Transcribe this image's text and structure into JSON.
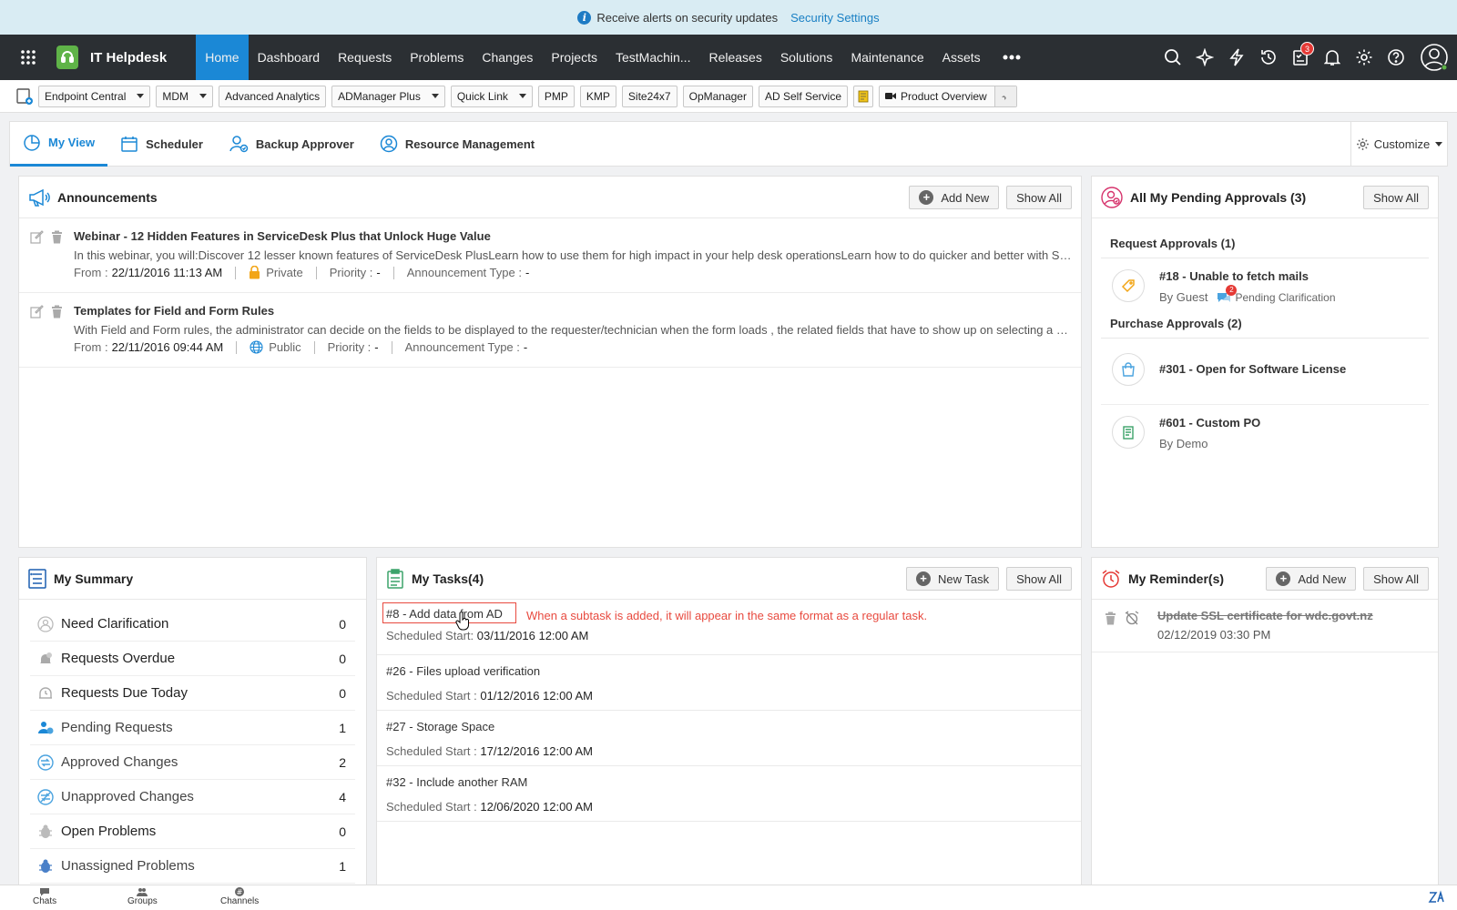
{
  "alert": {
    "text": "Receive alerts on security updates",
    "link": "Security Settings"
  },
  "nav": {
    "brand": "IT Helpdesk",
    "tabs": [
      "Home",
      "Dashboard",
      "Requests",
      "Problems",
      "Changes",
      "Projects",
      "TestMachin...",
      "Releases",
      "Solutions",
      "Maintenance",
      "Assets"
    ],
    "active_tab": "Home",
    "tasks_badge": "3"
  },
  "toolbar": {
    "buttons": [
      "Endpoint Central",
      "MDM",
      "Advanced Analytics",
      "ADManager Plus",
      "Quick Link",
      "PMP",
      "KMP",
      "Site24x7",
      "OpManager",
      "AD Self Service",
      "Product Overview"
    ]
  },
  "subtabs": {
    "tabs": [
      "My View",
      "Scheduler",
      "Backup Approver",
      "Resource Management"
    ],
    "customize": "Customize"
  },
  "announcements": {
    "title": "Announcements",
    "add_new": "Add New",
    "show_all": "Show All",
    "from_label": "From :",
    "priority_label": "Priority :",
    "type_label": "Announcement Type :",
    "items": [
      {
        "title": "Webinar - 12 Hidden Features in ServiceDesk Plus that Unlock Huge Value",
        "desc": "In this webinar, you will:Discover 12 lesser known features of ServiceDesk PlusLearn how to use them for high impact in your help desk operationsLearn how to do quicker and better with ServiceDesk Plus",
        "from": "22/11/2016 11:13 AM",
        "visibility": "Private",
        "priority": "-",
        "type": "-"
      },
      {
        "title": "Templates for Field and Form Rules",
        "desc": "With Field and Form rules, the administrator can decide on the fields to be displayed to the requester/technician when the form loads , the related fields that have to show up on selecting a value",
        "from": "22/11/2016 09:44 AM",
        "visibility": "Public",
        "priority": "-",
        "type": "-"
      }
    ]
  },
  "approvals": {
    "title": "All My Pending Approvals (3)",
    "show_all": "Show All",
    "request_header": "Request Approvals (1)",
    "purchase_header": "Purchase Approvals (2)",
    "request_items": [
      {
        "title": "#18 - Unable to fetch mails",
        "by": "By Guest",
        "status": "Pending Clarification",
        "status_badge": "2"
      }
    ],
    "purchase_items": [
      {
        "title": "#301 - Open for Software License",
        "by": ""
      },
      {
        "title": "#601 - Custom PO",
        "by": "By Demo"
      }
    ]
  },
  "summary": {
    "title": "My Summary",
    "rows": [
      {
        "label": "Need Clarification",
        "count": "0"
      },
      {
        "label": "Requests Overdue",
        "count": "0"
      },
      {
        "label": "Requests Due Today",
        "count": "0"
      },
      {
        "label": "Pending Requests",
        "count": "1"
      },
      {
        "label": "Approved Changes",
        "count": "2"
      },
      {
        "label": "Unapproved Changes",
        "count": "4"
      },
      {
        "label": "Open Problems",
        "count": "0"
      },
      {
        "label": "Unassigned Problems",
        "count": "1"
      }
    ]
  },
  "tasks": {
    "title": "My Tasks(4)",
    "new_task": "New Task",
    "show_all": "Show All",
    "note": "When a subtask is added, it will appear in the same format as a regular task.",
    "items": [
      {
        "title": "#8 - Add data from AD",
        "label": "Scheduled Start:",
        "date": "03/11/2016 12:00 AM"
      },
      {
        "title": "#26 - Files upload verification",
        "label": "Scheduled Start :",
        "date": "01/12/2016 12:00 AM"
      },
      {
        "title": "#27 - Storage Space",
        "label": "Scheduled Start :",
        "date": "17/12/2016 12:00 AM"
      },
      {
        "title": "#32 - Include another RAM",
        "label": "Scheduled Start :",
        "date": "12/06/2020 12:00 AM"
      }
    ]
  },
  "reminders": {
    "title": "My Reminder(s)",
    "add_new": "Add New",
    "show_all": "Show All",
    "items": [
      {
        "title": "Update SSL certificate for wdc.govt.nz",
        "date": "02/12/2019 03:30 PM"
      }
    ]
  },
  "chatbar": {
    "items": [
      "Chats",
      "Groups",
      "Channels"
    ]
  },
  "colors": {
    "nav_bg": "#2b2f33",
    "accent": "#1b88d6",
    "alert_bg": "#d9ecf3",
    "note_red": "#e84a3f"
  }
}
